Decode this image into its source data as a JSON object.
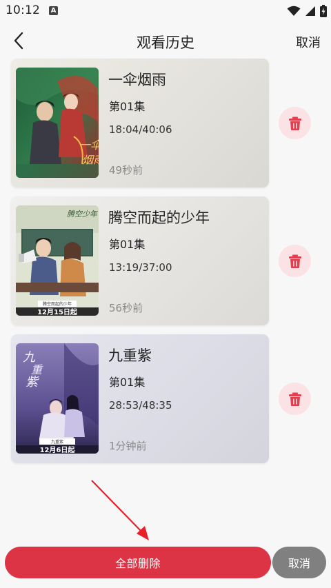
{
  "status_bar": {
    "time": "10:12",
    "indicator": "A",
    "icons": [
      "wifi-icon",
      "signal-icon",
      "battery-icon"
    ]
  },
  "header": {
    "title": "观看历史",
    "cancel_label": "取消",
    "back_icon": "chevron-left-icon"
  },
  "history": [
    {
      "title": "一伞烟雨",
      "episode": "第01集",
      "progress": "18:04/40:06",
      "time_ago": "49秒前",
      "poster_caption": "一伞烟雨"
    },
    {
      "title": "腾空而起的少年",
      "episode": "第01集",
      "progress": "13:19/37:00",
      "time_ago": "56秒前",
      "poster_caption": "12月15日起"
    },
    {
      "title": "九重紫",
      "episode": "第01集",
      "progress": "28:53/48:35",
      "time_ago": "1分钟前",
      "poster_caption": "12月6日起"
    }
  ],
  "footer": {
    "delete_all_label": "全部删除",
    "cancel_label": "取消"
  },
  "colors": {
    "accent": "#dc3444",
    "delete_bg": "#fbe3e5",
    "cancel_bg": "#808080",
    "arrow": "#e8202a"
  }
}
